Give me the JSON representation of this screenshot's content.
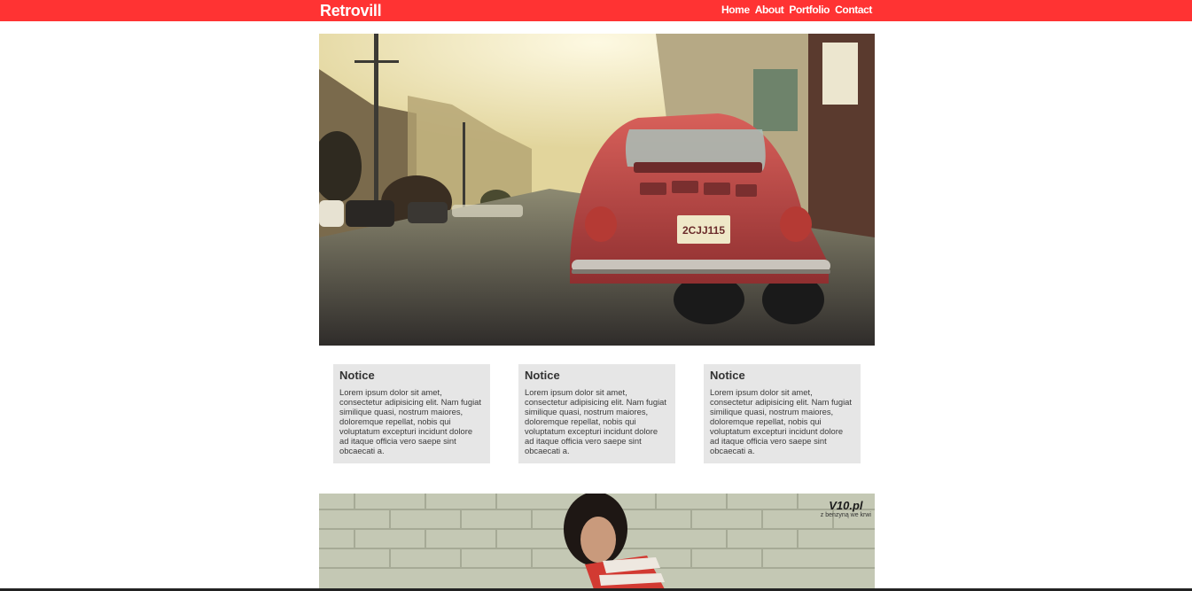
{
  "header": {
    "brand": "Retrovill",
    "nav": [
      "Home",
      "About",
      "Portfolio",
      "Contact"
    ]
  },
  "cards": [
    {
      "title": "Notice",
      "body": "Lorem ipsum dolor sit amet, consectetur adipisicing elit. Nam fugiat similique quasi, nostrum maiores, doloremque repellat, nobis qui voluptatum excepturi incidunt dolore ad itaque officia vero saepe sint obcaecati a."
    },
    {
      "title": "Notice",
      "body": "Lorem ipsum dolor sit amet, consectetur adipisicing elit. Nam fugiat similique quasi, nostrum maiores, doloremque repellat, nobis qui voluptatum excepturi incidunt dolore ad itaque officia vero saepe sint obcaecati a."
    },
    {
      "title": "Notice",
      "body": "Lorem ipsum dolor sit amet, consectetur adipisicing elit. Nam fugiat similique quasi, nostrum maiores, doloremque repellat, nobis qui voluptatum excepturi incidunt dolore ad itaque officia vero saepe sint obcaecati a."
    }
  ],
  "hero": {
    "plate": "2CJJ115"
  },
  "second_image": {
    "watermark_logo": "V10.pl",
    "watermark_tagline": "z benzyną we krwi"
  },
  "colors": {
    "accent": "#ff3333",
    "card_bg": "#e6e6e6"
  }
}
